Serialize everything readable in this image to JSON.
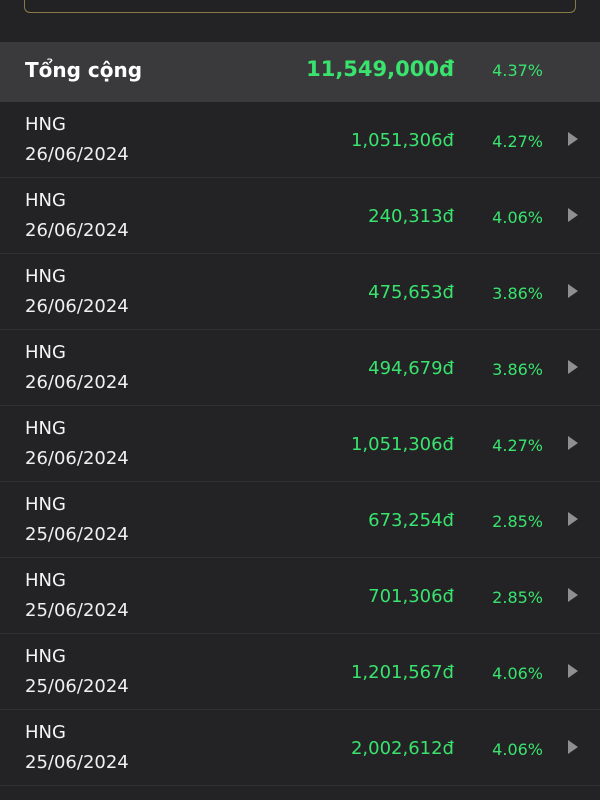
{
  "summary": {
    "label": "Tổng cộng",
    "amount": "11,549,000đ",
    "percent": "4.37%"
  },
  "rows": [
    {
      "ticker": "HNG",
      "date": "26/06/2024",
      "amount": "1,051,306đ",
      "percent": "4.27%"
    },
    {
      "ticker": "HNG",
      "date": "26/06/2024",
      "amount": "240,313đ",
      "percent": "4.06%"
    },
    {
      "ticker": "HNG",
      "date": "26/06/2024",
      "amount": "475,653đ",
      "percent": "3.86%"
    },
    {
      "ticker": "HNG",
      "date": "26/06/2024",
      "amount": "494,679đ",
      "percent": "3.86%"
    },
    {
      "ticker": "HNG",
      "date": "26/06/2024",
      "amount": "1,051,306đ",
      "percent": "4.27%"
    },
    {
      "ticker": "HNG",
      "date": "25/06/2024",
      "amount": "673,254đ",
      "percent": "2.85%"
    },
    {
      "ticker": "HNG",
      "date": "25/06/2024",
      "amount": "701,306đ",
      "percent": "2.85%"
    },
    {
      "ticker": "HNG",
      "date": "25/06/2024",
      "amount": "1,201,567đ",
      "percent": "4.06%"
    },
    {
      "ticker": "HNG",
      "date": "25/06/2024",
      "amount": "2,002,612đ",
      "percent": "4.06%"
    }
  ],
  "icons": {
    "row_action": "chevron-right-icon"
  },
  "colors": {
    "positive": "#39e36d",
    "background": "#232326",
    "summary_background": "#3a3a3d"
  }
}
